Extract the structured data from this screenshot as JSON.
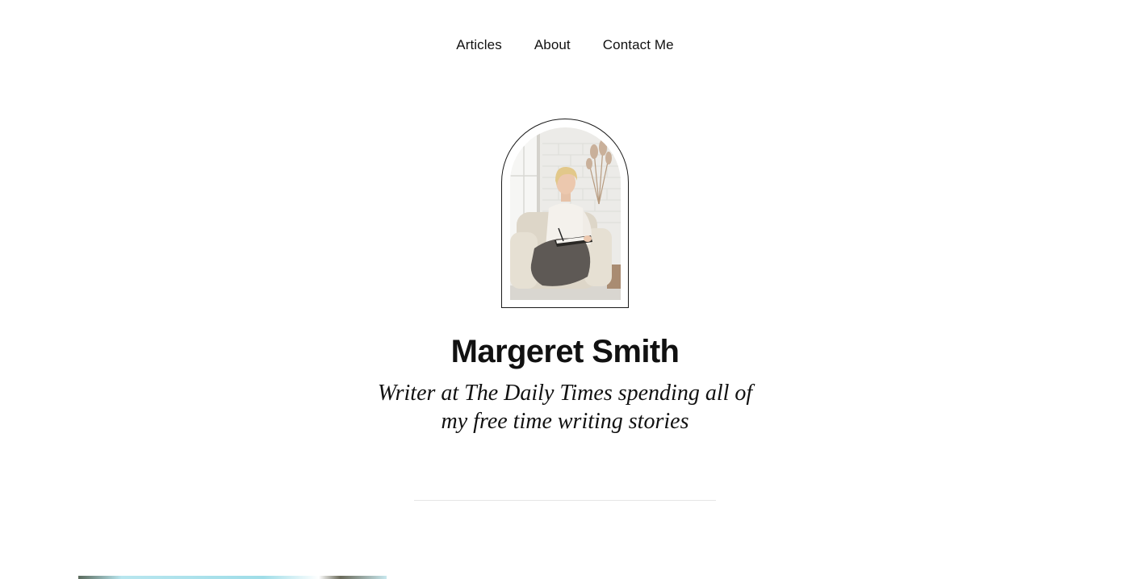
{
  "nav": {
    "items": [
      {
        "label": "Articles"
      },
      {
        "label": "About"
      },
      {
        "label": "Contact Me"
      }
    ]
  },
  "profile": {
    "name": "Margeret Smith",
    "tagline": "Writer at The Daily Times spending all of my free time writing stories"
  },
  "icons": {
    "portrait": "woman-writing-photo"
  },
  "colors": {
    "text": "#111111",
    "background": "#ffffff",
    "divider": "#e6e6e6"
  }
}
